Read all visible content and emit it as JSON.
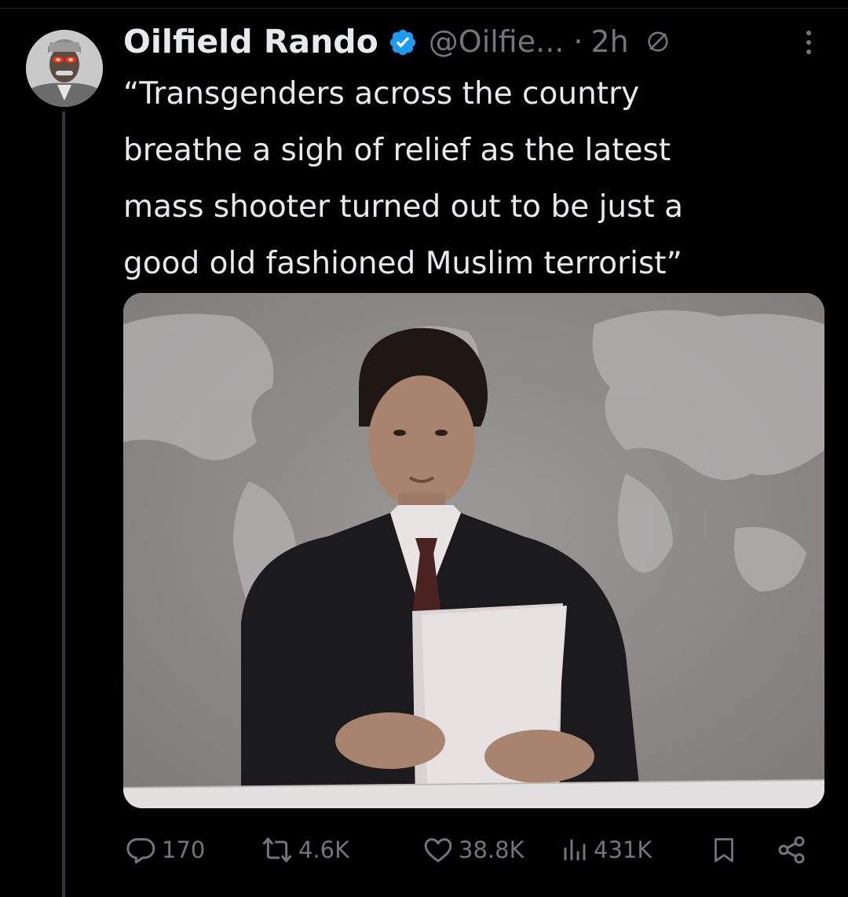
{
  "tweet": {
    "display_name": "Oilfield Rando",
    "handle": "@Oilfie...",
    "separator": "·",
    "time": "2h",
    "text_lines": [
      "“Transgenders across the country",
      "breathe a sigh of relief as the latest",
      "mass shooter turned out to be just a",
      "good old fashioned Muslim terrorist”"
    ]
  },
  "stats": {
    "replies": "170",
    "reposts": "4.6K",
    "likes": "38.8K",
    "views": "431K"
  },
  "icons": {
    "verified": "verified-badge-icon",
    "restricted": "no-entry-icon",
    "more": "more-options-icon",
    "reply": "reply-icon",
    "repost": "repost-icon",
    "like": "like-icon",
    "views": "views-icon",
    "bookmark": "bookmark-icon",
    "share": "share-icon"
  },
  "colors": {
    "background": "#000000",
    "text": "#e7e9ea",
    "muted": "#71767b",
    "verified": "#1d9bf0"
  }
}
